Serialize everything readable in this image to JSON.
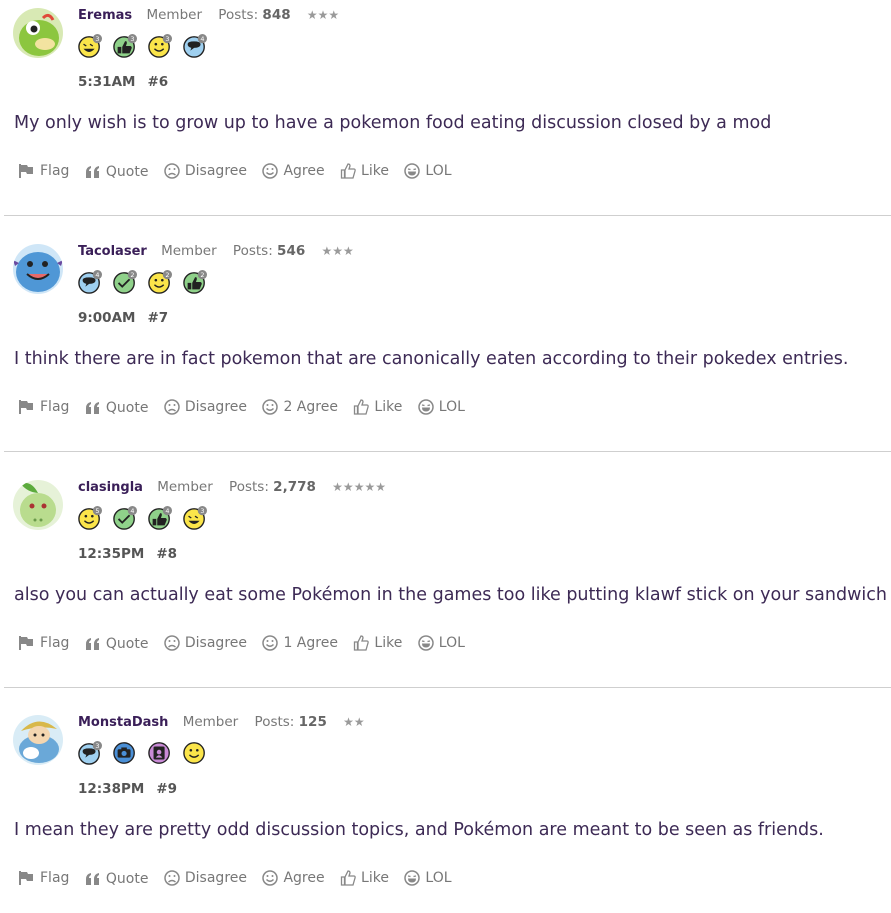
{
  "posts": [
    {
      "username": "Eremas",
      "role": "Member",
      "posts_label": "Posts:",
      "posts_count": "848",
      "stars": "★★★",
      "avatar": "caterpie-avatar",
      "badges": [
        {
          "icon": "laugh-badge-icon",
          "count": "3"
        },
        {
          "icon": "thumbs-up-badge-icon",
          "count": "3"
        },
        {
          "icon": "smile-badge-icon",
          "count": "3"
        },
        {
          "icon": "comment-badge-icon",
          "count": "4"
        }
      ],
      "time": "5:31AM",
      "number": "#6",
      "text": "My only wish is to grow up to have a pokemon food eating discussion closed by a mod",
      "actions": {
        "flag": "Flag",
        "quote": "Quote",
        "disagree": "Disagree",
        "agree": "Agree",
        "like": "Like",
        "lol": "LOL"
      }
    },
    {
      "username": "Tacolaser",
      "role": "Member",
      "posts_label": "Posts:",
      "posts_count": "546",
      "stars": "★★★",
      "avatar": "wooper-avatar",
      "badges": [
        {
          "icon": "comment-badge-icon",
          "count": "4"
        },
        {
          "icon": "check-badge-icon",
          "count": "2"
        },
        {
          "icon": "smile-badge-icon",
          "count": "2"
        },
        {
          "icon": "thumbs-up-badge-icon",
          "count": "2"
        }
      ],
      "time": "9:00AM",
      "number": "#7",
      "text": "I think there are in fact pokemon that are canonically eaten according to their pokedex entries.",
      "actions": {
        "flag": "Flag",
        "quote": "Quote",
        "disagree": "Disagree",
        "agree": "2 Agree",
        "like": "Like",
        "lol": "LOL"
      }
    },
    {
      "username": "clasingla",
      "role": "Member",
      "posts_label": "Posts:",
      "posts_count": "2,778",
      "stars": "★★★★★",
      "avatar": "chikorita-avatar",
      "badges": [
        {
          "icon": "smile-badge-icon",
          "count": "5"
        },
        {
          "icon": "check-badge-icon",
          "count": "4"
        },
        {
          "icon": "thumbs-up-badge-icon",
          "count": "4"
        },
        {
          "icon": "laugh-badge-icon",
          "count": "3"
        }
      ],
      "time": "12:35PM",
      "number": "#8",
      "text": "also you can actually eat some Pokémon in the games too like putting klawf stick on your sandwich",
      "actions": {
        "flag": "Flag",
        "quote": "Quote",
        "disagree": "Disagree",
        "agree": "1 Agree",
        "like": "Like",
        "lol": "LOL"
      }
    },
    {
      "username": "MonstaDash",
      "role": "Member",
      "posts_label": "Posts:",
      "posts_count": "125",
      "stars": "★★",
      "avatar": "explorer-avatar",
      "badges": [
        {
          "icon": "comment-badge-icon",
          "count": "3"
        },
        {
          "icon": "camera-badge-icon",
          "count": ""
        },
        {
          "icon": "contact-badge-icon",
          "count": ""
        },
        {
          "icon": "smile-badge-icon",
          "count": ""
        }
      ],
      "time": "12:38PM",
      "number": "#9",
      "text": "I mean they are pretty odd discussion topics, and Pokémon are meant to be seen as friends.",
      "actions": {
        "flag": "Flag",
        "quote": "Quote",
        "disagree": "Disagree",
        "agree": "Agree",
        "like": "Like",
        "lol": "LOL"
      }
    }
  ],
  "colors": {
    "username": "#3a1f58",
    "body_text": "#3d2a55",
    "meta": "#777777",
    "divider": "#cfcfcf"
  }
}
